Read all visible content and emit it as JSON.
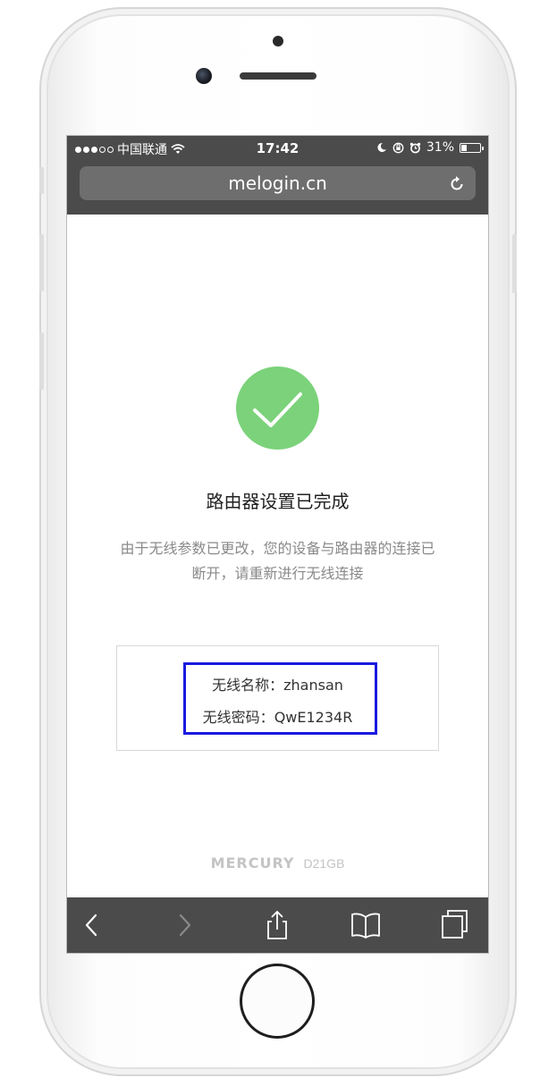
{
  "status_bar": {
    "carrier": "中国联通",
    "time": "17:42",
    "battery_pct": "31%",
    "signal_bars_filled": 3,
    "signal_bars_total": 5,
    "battery_level": 0.31
  },
  "browser": {
    "url": "melogin.cn"
  },
  "page": {
    "title": "路由器设置已完成",
    "description": "由于无线参数已更改，您的设备与路由器的连接已断开，请重新进行无线连接",
    "wifi": {
      "name_label": "无线名称：",
      "name_value": "zhansan",
      "password_label": "无线密码：",
      "password_value": "QwE1234R"
    },
    "brand": "MERCURY",
    "model": "D21GB"
  },
  "colors": {
    "success_green": "#7bd27a",
    "highlight_blue": "#1a1adf",
    "chrome_dark": "#4b4b4b"
  },
  "icons": {
    "success": "check-icon",
    "reload": "reload-icon",
    "back": "chevron-left-icon",
    "forward": "chevron-right-icon",
    "share": "share-icon",
    "bookmarks": "book-icon",
    "tabs": "tabs-icon"
  }
}
